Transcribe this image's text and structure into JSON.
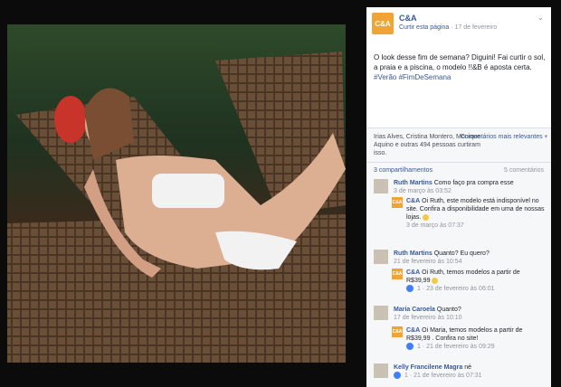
{
  "post": {
    "page_name": "C&A",
    "logo_text": "C&A",
    "follow_label": "Curtir esta página",
    "date": "17 de fevereiro",
    "caption": "O look desse fim de semana? Diguini! Fai curtir o sol, a praia e a piscina, o modelo !!&B é aposta certa.",
    "hashtags": "#Verão #FimDeSemana"
  },
  "reactions": {
    "text": "Irias Alves, Cristina Montero, Monique Aquino e outras 494 pessoas curtiram isso.",
    "sort_label": "Comentários mais relevantes",
    "sort_chevron": "▾",
    "shares": "3 compartilhamentos",
    "comments_count": "5 comentários"
  },
  "comments": [
    {
      "author": "Ruth Martins",
      "text": "Como faço pra compra esse",
      "meta": "3 de março às 03:52"
    },
    {
      "author": "C&A",
      "text": "Oi Ruth, este modelo está indisponível no site. Confira a disponibilidade em uma de nossas lojas.",
      "meta": "3 de março às 07:37",
      "reply": true
    },
    {
      "author": "Ruth Martins",
      "text": "Quanto? Eu quero?",
      "meta": "21 de fevereiro às 10:54"
    },
    {
      "author": "C&A",
      "text": "Oi Ruth, temos modelos a partir de R$39,99",
      "meta": "1 · 23 de fevereiro às 06:01",
      "reply": true
    },
    {
      "author": "Maria Caroela",
      "text": "Quanto?",
      "meta": "17 de fevereiro às 10:10"
    },
    {
      "author": "C&A",
      "text": "Oi Maria, temos modelos a partir de R$39,99 . Confira no site!",
      "meta": "1 · 21 de fevereiro às 09:29",
      "reply": true
    },
    {
      "author": "Kelly Francilene Magra",
      "text": "né",
      "meta": "1 · 21 de fevereiro às 07:31"
    }
  ],
  "icons": {
    "chevron": "⌄"
  },
  "colors": {
    "link": "#365899",
    "brand": "#f1a334",
    "muted": "#90949c"
  }
}
